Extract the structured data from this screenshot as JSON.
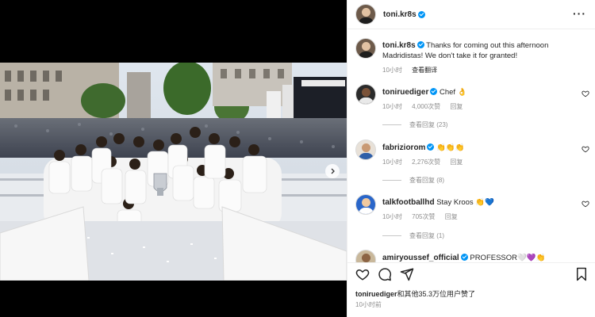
{
  "post": {
    "author": "toni.kr8s",
    "caption": "Thanks for coming out this afternoon Madridistas! We don't take it for granted!",
    "caption_time": "10小时",
    "translate_label": "查看翻译"
  },
  "comments": [
    {
      "username": "toniruediger",
      "text": "Chef 👌",
      "time": "10小时",
      "likes": "4,000次赞",
      "reply": "回复",
      "view_replies": "查看回复 (23)"
    },
    {
      "username": "fabriziorom",
      "text": "👏👏👏",
      "time": "10小时",
      "likes": "2,276次赞",
      "reply": "回复",
      "view_replies": "查看回复 (8)"
    },
    {
      "username": "talkfootballhd",
      "text": "Stay Kroos 👏💙",
      "time": "10小时",
      "likes": "705次赞",
      "reply": "回复",
      "view_replies": "查看回复 (1)"
    },
    {
      "username": "amiryoussef_official",
      "text": "PROFESSOR🤍💜👏",
      "time": "",
      "likes": "",
      "reply": "",
      "view_replies": ""
    }
  ],
  "footer": {
    "liked_by_user": "toniruediger",
    "liked_by_rest": "和其他35.3万位用户赞了",
    "time": "10小时前"
  },
  "colors": {
    "verified": "#0095f6",
    "muted_text": "#8e8e8e",
    "media_bg": "#000000"
  },
  "icons": [
    "more-icon",
    "heart-icon",
    "comment-icon",
    "share-icon",
    "save-icon",
    "chevron-right-icon",
    "verified-icon"
  ]
}
